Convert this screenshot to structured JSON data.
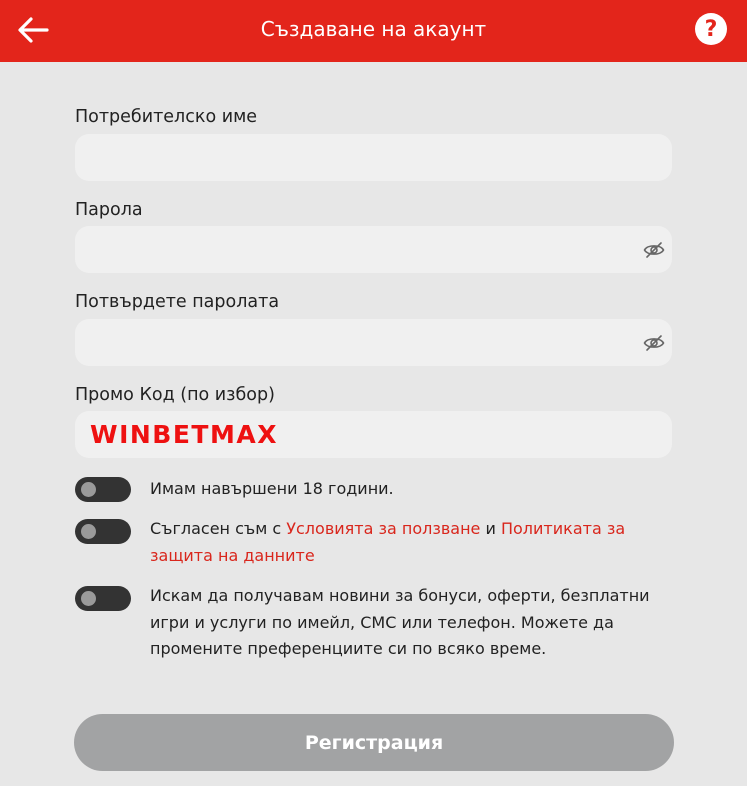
{
  "header": {
    "title": "Създаване на акаунт",
    "back_icon": "arrow-left-icon",
    "help_icon": "question-circle-icon",
    "help_glyph": "?",
    "brand_color": "#e3251b"
  },
  "form": {
    "username": {
      "label": "Потребителско име",
      "value": "",
      "placeholder": ""
    },
    "password": {
      "label": "Парола",
      "value": "",
      "placeholder": "",
      "visibility_icon": "eye-off-icon"
    },
    "confirm_password": {
      "label": "Потвърдете паролата",
      "value": "",
      "placeholder": "",
      "visibility_icon": "eye-off-icon"
    },
    "promo": {
      "label": "Промо Код (по избор)",
      "value": "WINBETMAX",
      "value_color": "#ee1111"
    }
  },
  "checkboxes": {
    "age": {
      "text": "Имам навършени 18 години.",
      "checked": false
    },
    "terms": {
      "prefix": "Съгласен съм с ",
      "link1": "Условията за ползване",
      "middle": " и ",
      "link2": "Политиката за защита на данните",
      "checked": false
    },
    "marketing": {
      "text": "Искам да получавам новини за бонуси, оферти, безплатни игри и услуги по имейл, СМС или телефон. Можете да промените преференциите си по всяко време.",
      "checked": false
    }
  },
  "submit": {
    "label": "Регистрация",
    "enabled": false
  }
}
